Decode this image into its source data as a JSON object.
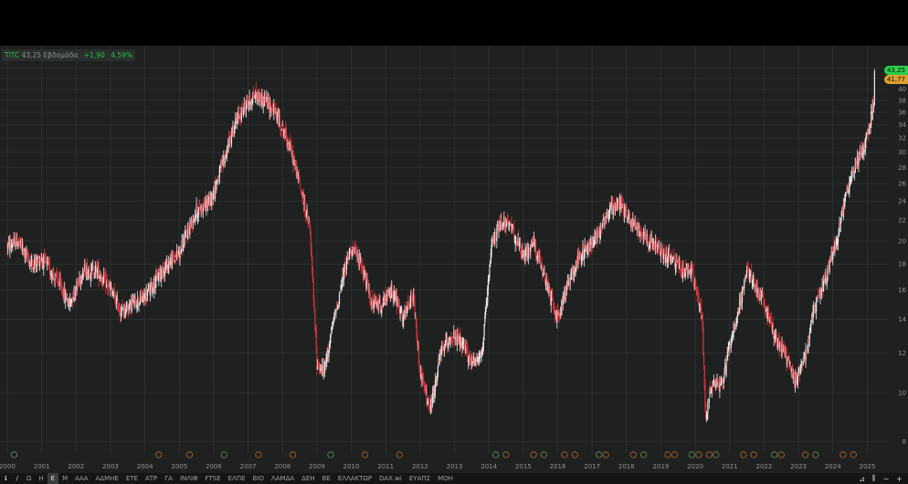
{
  "legend": {
    "symbol": "TITC",
    "price": "43,25",
    "interval": "Εβδομάδα",
    "change": "+1,90",
    "change_pct": "4,59%"
  },
  "price_tags": {
    "last": "43,25",
    "prev": "41,77"
  },
  "toolbar": {
    "items": [
      "Ω",
      "Η",
      "Ε",
      "Μ",
      "ΑΑΑ",
      "ΑΔΜΗΕ",
      "ΕΤΕ",
      "ΑΤΡ",
      "ΓΑ",
      "ΙΝΛΙΦ",
      "FTSE",
      "ΕΛΠΕ",
      "ΒΙΟ",
      "ΛΑΜΔΑ",
      "ΔΕΗ",
      "ΒΕ",
      "ΕΛΛΑΚΤΩΡ",
      "DAX.wi",
      "ΕΥΑΠΣ",
      "ΜΟΗ"
    ],
    "active": "Ε"
  },
  "colors": {
    "background": "#1e2120",
    "grid": "#2c302e",
    "up": "#e8e8e8",
    "down": "#d8333a",
    "axis_text": "#8e938f",
    "accent_green": "#2bd04a",
    "accent_orange": "#e0a030"
  },
  "chart_data": {
    "type": "candlestick",
    "symbol": "TITC",
    "interval": "Εβδομάδα",
    "scale": "log",
    "ylim": [
      7.6,
      48
    ],
    "y_ticks": [
      8,
      10,
      12,
      14,
      16,
      18,
      20,
      22,
      24,
      26,
      28,
      30,
      32,
      34,
      36,
      38,
      40,
      42,
      44
    ],
    "x_ticks": [
      "2000",
      "2001",
      "2002",
      "2003",
      "2004",
      "2005",
      "2006",
      "2007",
      "2008",
      "2009",
      "2010",
      "2011",
      "2012",
      "2013",
      "2014",
      "2015",
      "2016",
      "2017",
      "2018",
      "2019",
      "2020",
      "2021",
      "2022",
      "2023",
      "2024",
      "2025"
    ],
    "grid": true,
    "price_trend": {
      "x": [
        2000.0,
        2000.3,
        2000.7,
        2001.0,
        2001.5,
        2001.8,
        2002.2,
        2002.6,
        2003.0,
        2003.3,
        2003.6,
        2004.0,
        2004.5,
        2005.0,
        2005.5,
        2005.9,
        2006.3,
        2006.6,
        2006.9,
        2007.2,
        2007.5,
        2007.8,
        2008.2,
        2008.5,
        2008.8,
        2009.0,
        2009.2,
        2009.5,
        2009.8,
        2010.0,
        2010.3,
        2010.6,
        2010.9,
        2011.2,
        2011.5,
        2011.8,
        2012.0,
        2012.3,
        2012.6,
        2012.9,
        2013.2,
        2013.5,
        2013.8,
        2014.1,
        2014.4,
        2014.7,
        2015.0,
        2015.3,
        2015.6,
        2016.0,
        2016.3,
        2016.6,
        2016.9,
        2017.2,
        2017.5,
        2017.8,
        2018.1,
        2018.4,
        2018.7,
        2019.0,
        2019.3,
        2019.6,
        2019.9,
        2020.2,
        2020.3,
        2020.5,
        2020.8,
        2021.0,
        2021.3,
        2021.5,
        2021.8,
        2022.0,
        2022.3,
        2022.6,
        2022.9,
        2023.2,
        2023.5,
        2023.8,
        2024.1,
        2024.4,
        2024.7,
        2025.0,
        2025.2
      ],
      "y": [
        19.5,
        20,
        18,
        18.5,
        16.5,
        15,
        17.5,
        17.5,
        16,
        14.5,
        15,
        15.5,
        17.5,
        19,
        23,
        24,
        29,
        34,
        37,
        39,
        38,
        36,
        31,
        26,
        21,
        11.5,
        11,
        14,
        17.5,
        19.5,
        18,
        15,
        15,
        16,
        14,
        15.5,
        11,
        9.2,
        12,
        13,
        12.5,
        11.5,
        12,
        20,
        22,
        21,
        18.5,
        20,
        17,
        14,
        16.5,
        18.5,
        19.5,
        21,
        23,
        24,
        22,
        21,
        20,
        19,
        18.5,
        17.5,
        17.5,
        14,
        9,
        10.5,
        10.5,
        12.5,
        15,
        17.5,
        16,
        15,
        13,
        12,
        10.5,
        12,
        15,
        17,
        20,
        25,
        29,
        32,
        38,
        43
      ]
    }
  }
}
